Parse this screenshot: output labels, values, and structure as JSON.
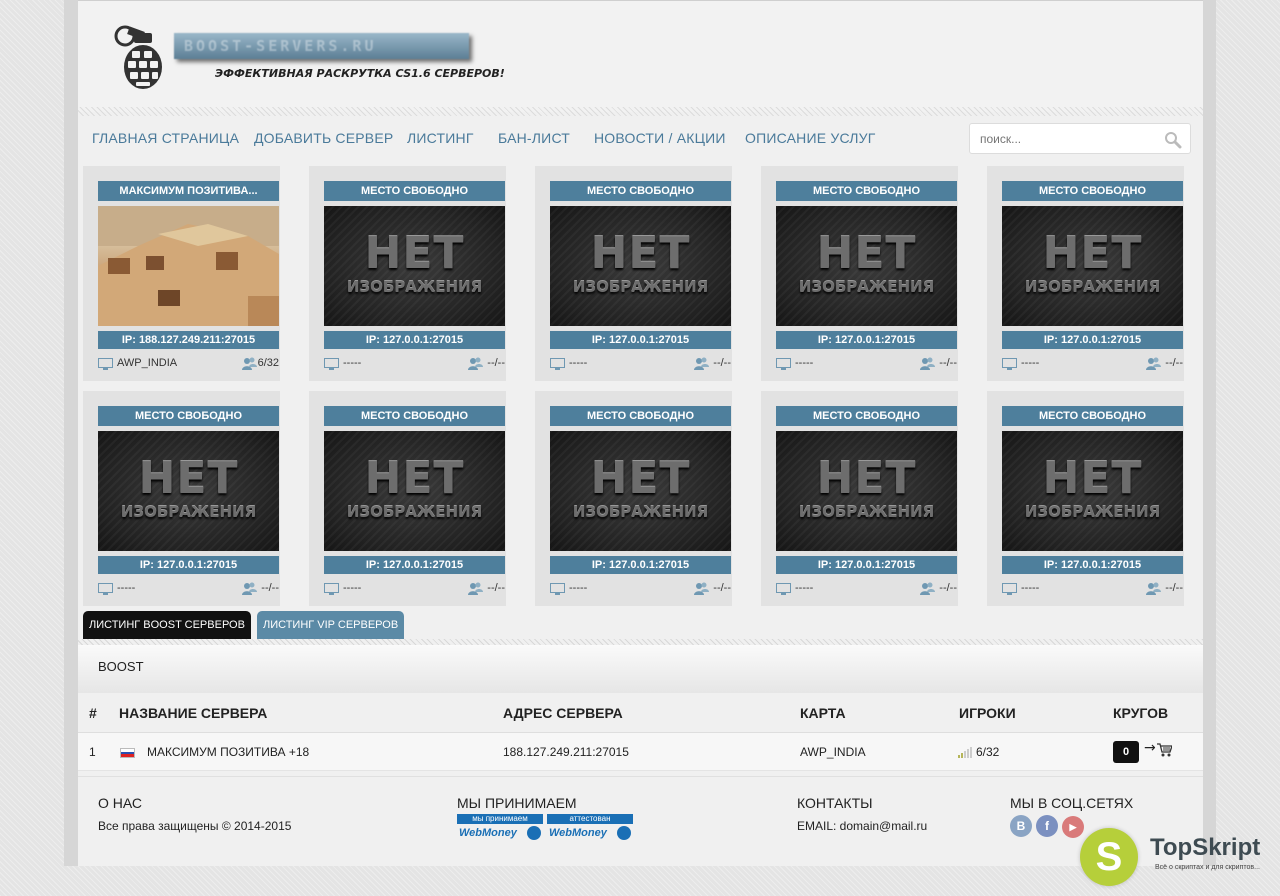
{
  "header": {
    "logo_text": "BOOST-SERVERS.RU",
    "tagline": "ЭФФЕКТИВНАЯ РАСКРУТКА CS1.6 СЕРВЕРОВ!"
  },
  "nav": {
    "items": [
      {
        "label": "ГЛАВНАЯ СТРАНИЦА"
      },
      {
        "label": "ДОБАВИТЬ СЕРВЕР"
      },
      {
        "label": "ЛИСТИНГ"
      },
      {
        "label": "БАН-ЛИСТ"
      },
      {
        "label": "НОВОСТИ / АКЦИИ"
      },
      {
        "label": "ОПИСАНИЕ УСЛУГ"
      }
    ],
    "search_placeholder": "поиск..."
  },
  "cards": [
    {
      "title": "МАКСИМУМ ПОЗИТИВА...",
      "ip": "IP: 188.127.249.211:27015",
      "map": "AWP_INDIA",
      "players": "6/32",
      "has_image": true
    },
    {
      "title": "МЕСТО СВОБОДНО",
      "ip": "IP: 127.0.0.1:27015",
      "map": "-----",
      "players": "--/--",
      "has_image": false
    },
    {
      "title": "МЕСТО СВОБОДНО",
      "ip": "IP: 127.0.0.1:27015",
      "map": "-----",
      "players": "--/--",
      "has_image": false
    },
    {
      "title": "МЕСТО СВОБОДНО",
      "ip": "IP: 127.0.0.1:27015",
      "map": "-----",
      "players": "--/--",
      "has_image": false
    },
    {
      "title": "МЕСТО СВОБОДНО",
      "ip": "IP: 127.0.0.1:27015",
      "map": "-----",
      "players": "--/--",
      "has_image": false
    },
    {
      "title": "МЕСТО СВОБОДНО",
      "ip": "IP: 127.0.0.1:27015",
      "map": "-----",
      "players": "--/--",
      "has_image": false
    },
    {
      "title": "МЕСТО СВОБОДНО",
      "ip": "IP: 127.0.0.1:27015",
      "map": "-----",
      "players": "--/--",
      "has_image": false
    },
    {
      "title": "МЕСТО СВОБОДНО",
      "ip": "IP: 127.0.0.1:27015",
      "map": "-----",
      "players": "--/--",
      "has_image": false
    },
    {
      "title": "МЕСТО СВОБОДНО",
      "ip": "IP: 127.0.0.1:27015",
      "map": "-----",
      "players": "--/--",
      "has_image": false
    },
    {
      "title": "МЕСТО СВОБОДНО",
      "ip": "IP: 127.0.0.1:27015",
      "map": "-----",
      "players": "--/--",
      "has_image": false
    }
  ],
  "no_image": {
    "line1": "НЕТ",
    "line2": "ИЗОБРАЖЕНИЯ"
  },
  "tabs": [
    {
      "label": "ЛИСТИНГ BOOST СЕРВЕРОВ",
      "active": true
    },
    {
      "label": "ЛИСТИНГ VIP СЕРВЕРОВ",
      "active": false
    }
  ],
  "section_title": "BOOST",
  "table": {
    "headers": {
      "num": "#",
      "name": "НАЗВАНИЕ СЕРВЕРА",
      "address": "АДРЕС СЕРВЕРА",
      "map": "КАРТА",
      "players": "ИГРОКИ",
      "rounds": "КРУГОВ"
    },
    "rows": [
      {
        "num": "1",
        "name": "МАКСИМУМ ПОЗИТИВА +18",
        "address": "188.127.249.211:27015",
        "map": "AWP_INDIA",
        "players": "6/32",
        "rounds": "0"
      }
    ]
  },
  "footer": {
    "about_title": "О НАС",
    "copyright": "Все права защищены © 2014-2015",
    "pay_title": "МЫ ПРИНИМАЕМ",
    "wm1_top": "мы принимаем",
    "wm2_top": "аттестован",
    "wm_label": "WebMoney",
    "contacts_title": "КОНТАКТЫ",
    "email": "EMAIL: domain@mail.ru",
    "social_title": "МЫ В СОЦ.СЕТЯХ",
    "social": [
      "В",
      "f",
      "▶"
    ]
  },
  "watermark": {
    "letter": "S",
    "name": "TopSkript",
    "sub": "Всё о скриптах и для скриптов..."
  },
  "colors": {
    "accent": "#4e7f9c",
    "nav_link": "#4a7a9a",
    "active_tab": "#111111",
    "inactive_tab": "#5b8aa6"
  }
}
